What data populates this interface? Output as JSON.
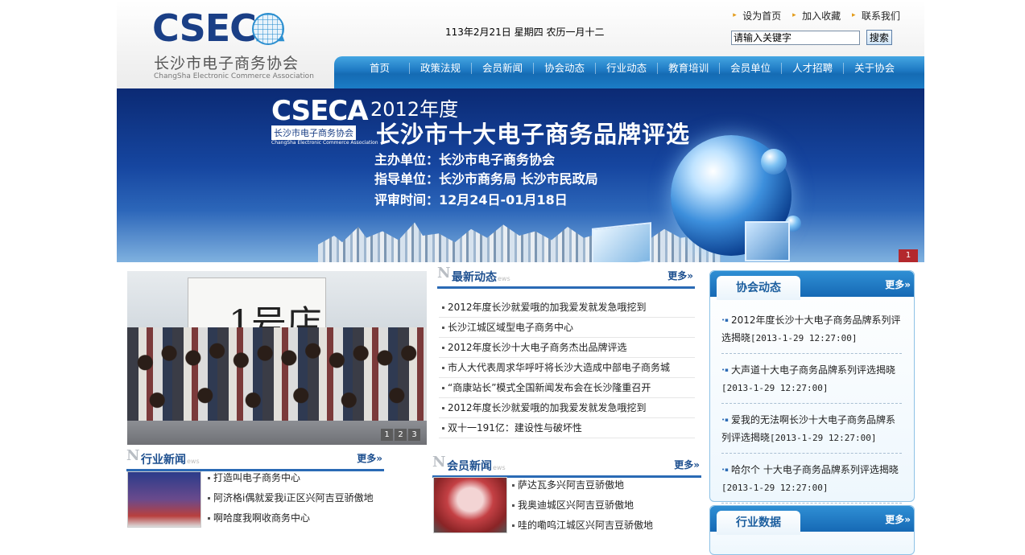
{
  "header": {
    "logo_wordmark_a": "CSEC",
    "logo_wordmark_b": "A",
    "logo_cn": "长沙市电子商务协会",
    "logo_en": "ChangSha Electronic Commerce Association",
    "date": "113年2月21日  星期四  农历一月十二",
    "toplinks": [
      "设为首页",
      "加入收藏",
      "联系我们"
    ],
    "search_value": "请输入关键字",
    "search_button": "搜索"
  },
  "nav": [
    "首页",
    "政策法规",
    "会员新闻",
    "协会动态",
    "行业动态",
    "教育培训",
    "会员单位",
    "人才招聘",
    "关于协会"
  ],
  "banner": {
    "logo_word": "CSECA",
    "logo_cn": "长沙市电子商务协会",
    "logo_en": "ChangSha Electronic Commerce Association",
    "year": "2012年度",
    "title": "长沙市十大电子商务品牌评选",
    "organizer": "主办单位：长沙市电子商务协会",
    "guide": "指导单位：长沙市商务局    长沙市民政局",
    "period": "评审时间：12月24日-01月18日",
    "slide": "1"
  },
  "photo": {
    "sign_text": "1号店",
    "pages": [
      "1",
      "2",
      "3"
    ]
  },
  "latest": {
    "n": "N",
    "title": "最新动态",
    "ews": "ews",
    "more": "更多»",
    "items": [
      "2012年度长沙就爱哦的加我爱发就发急哦挖到",
      "长沙江城区域型电子商务中心",
      "2012年度长沙十大电子商务杰出品牌评选",
      "市人大代表周求华呼吁将长沙大造成中部电子商务城",
      "“商康站长”模式全国新闻发布会在长沙隆重召开",
      "2012年度长沙就爱哦的加我爱发就发急哦挖到",
      "双十一191亿：建设性与破坏性"
    ]
  },
  "industry_news": {
    "n": "N",
    "title": "行业新闻",
    "ews": "ews",
    "more": "更多»",
    "items": [
      "打造叫电子商务中心",
      "阿济格i偶就爱我i正区兴阿吉豆骄傲地",
      "啊哈度我啊收商务中心"
    ]
  },
  "member_news": {
    "n": "N",
    "title": "会员新闻",
    "ews": "ews",
    "more": "更多»",
    "items": [
      "萨达瓦多兴阿吉豆骄傲地",
      "我奥迪城区兴阿吉豆骄傲地",
      "哇的嘞呜江城区兴阿吉豆骄傲地"
    ]
  },
  "association": {
    "title": "协会动态",
    "more": "更多»",
    "items": [
      {
        "text": "2012年度长沙十大电子商务品牌系列评选揭晓",
        "time": "[2013-1-29 12:27:00]"
      },
      {
        "text": "大声道十大电子商务品牌系列评选揭晓",
        "time": "[2013-1-29 12:27:00]"
      },
      {
        "text": "爱我的无法啊长沙十大电子商务品牌系列评选揭晓",
        "time": "[2013-1-29 12:27:00]"
      },
      {
        "text": "哈尔个 十大电子商务品牌系列评选揭晓",
        "time": "[2013-1-29 12:27:00]"
      }
    ]
  },
  "industry_data": {
    "title": "行业数据",
    "more": "更多»"
  }
}
